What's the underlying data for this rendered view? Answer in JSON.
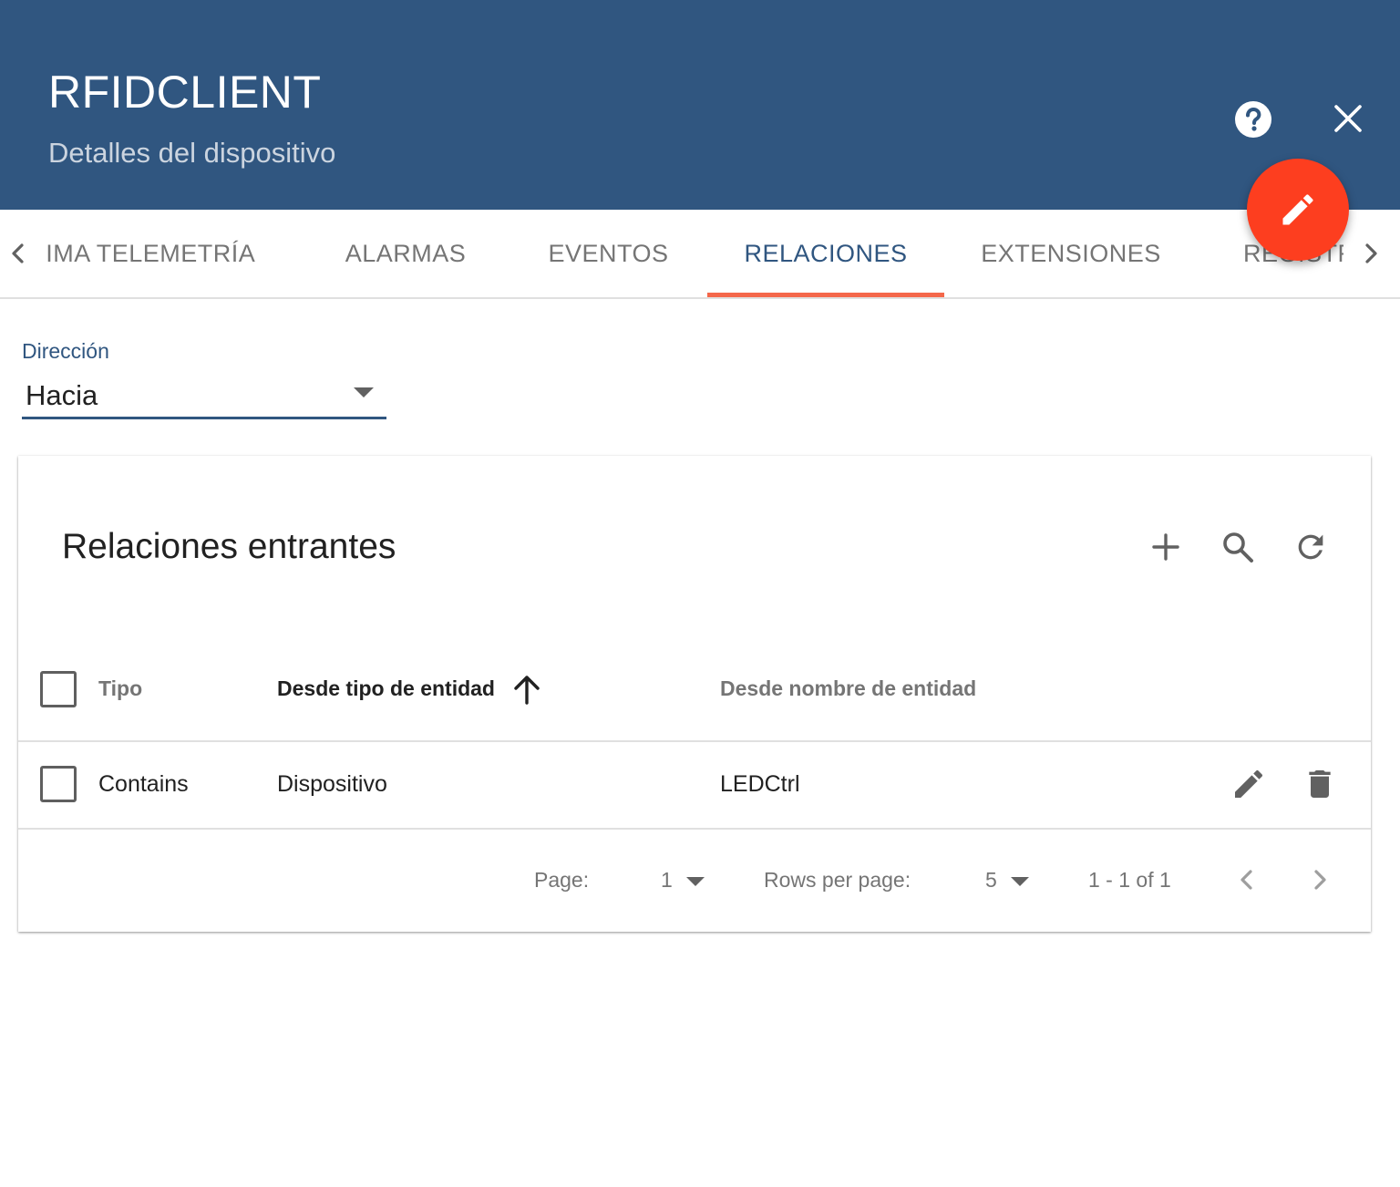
{
  "header": {
    "title": "RFIDCLIENT",
    "subtitle": "Detalles del dispositivo",
    "help_icon": "help-icon",
    "close_icon": "close-icon",
    "edit_icon": "pencil-icon",
    "background": "#305680",
    "fab_color": "#fd3e1f"
  },
  "tabs": {
    "items": [
      {
        "label": "ÚLTIMA TELEMETRÍA"
      },
      {
        "label": "ALARMAS"
      },
      {
        "label": "EVENTOS"
      },
      {
        "label": "RELACIONES",
        "active": true
      },
      {
        "label": "EXTENSIONES"
      },
      {
        "label": "REGISTRO DE AUDITORÍA"
      }
    ],
    "active_color": "#305680",
    "ink_color": "#f4674a"
  },
  "direction": {
    "label": "Dirección",
    "value": "Hacia"
  },
  "card": {
    "title": "Relaciones entrantes",
    "toolbar": [
      "add-icon",
      "search-icon",
      "refresh-icon"
    ],
    "columns": [
      {
        "label": "Tipo"
      },
      {
        "label": "Desde tipo de entidad",
        "sorted": "asc"
      },
      {
        "label": "Desde nombre de entidad"
      }
    ],
    "rows": [
      {
        "type": "Contains",
        "from_type": "Dispositivo",
        "from_name": "LEDCtrl"
      }
    ],
    "pagination": {
      "page_label": "Page:",
      "page_value": "1",
      "rows_label": "Rows per page:",
      "rows_value": "5",
      "range": "1 - 1 of 1"
    }
  }
}
